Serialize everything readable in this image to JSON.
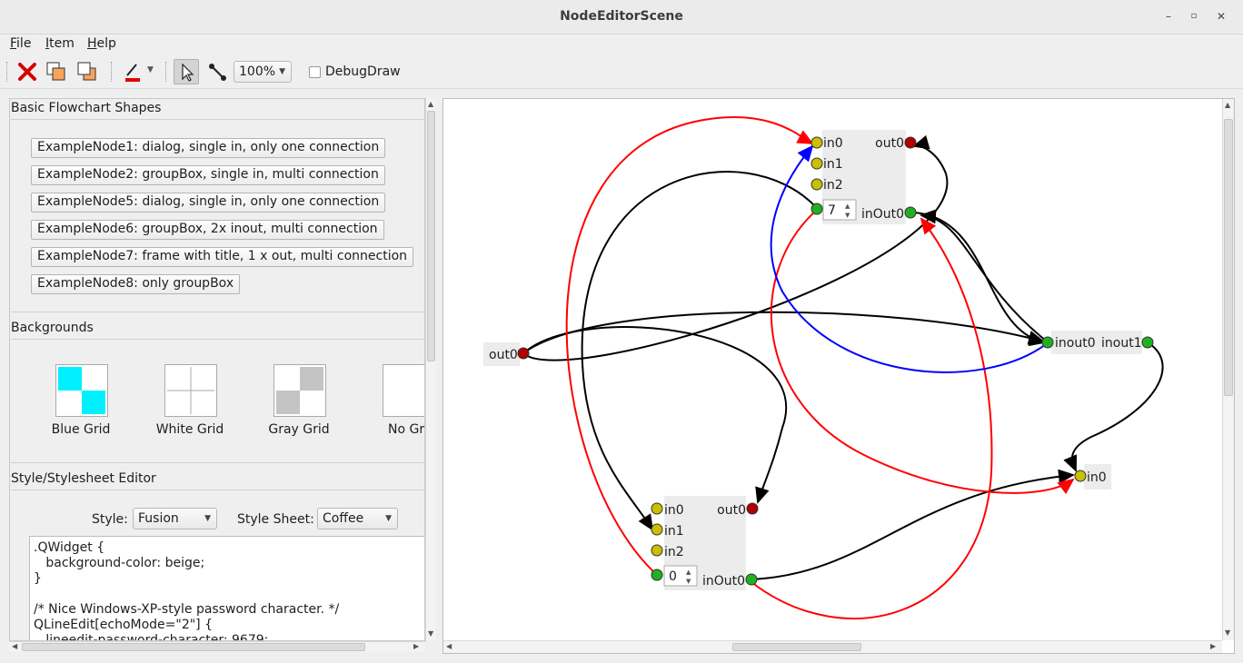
{
  "window": {
    "title": "NodeEditorScene"
  },
  "menu": {
    "items": [
      "File",
      "Item",
      "Help"
    ]
  },
  "toolbar": {
    "zoom": "100%",
    "debug_label": "DebugDraw",
    "debug_checked": false
  },
  "panel": {
    "shapes_title": "Basic Flowchart Shapes",
    "node_buttons": [
      "ExampleNode1: dialog, single in, only one connection",
      "ExampleNode2: groupBox, single in, multi connection",
      "ExampleNode5: dialog, single in, only one connection",
      "ExampleNode6: groupBox, 2x inout, multi connection",
      "ExampleNode7: frame with title, 1 x out, multi connection",
      "ExampleNode8: only groupBox"
    ],
    "backgrounds_title": "Backgrounds",
    "backgrounds": [
      "Blue Grid",
      "White Grid",
      "Gray Grid",
      "No Gri"
    ],
    "style_title": "Style/Stylesheet Editor",
    "style_label": "Style:",
    "style_value": "Fusion",
    "sheet_label": "Style Sheet:",
    "sheet_value": "Coffee",
    "editor_text": ".QWidget {\n   background-color: beige;\n}\n\n/* Nice Windows-XP-style password character. */\nQLineEdit[echoMode=\"2\"] {\n   lineedit-password-character: 9679;"
  },
  "scene": {
    "node_top": {
      "in0": "in0",
      "in1": "in1",
      "in2": "in2",
      "out0": "out0",
      "inout0": "inOut0",
      "spin": "7"
    },
    "node_bottom": {
      "in0": "in0",
      "in1": "in1",
      "in2": "in2",
      "out0": "out0",
      "inout0": "inOut0",
      "spin": "0"
    },
    "node_left": {
      "out0": "out0"
    },
    "node_right": {
      "inout0": "inout0",
      "inout1": "inout1"
    },
    "node_far": {
      "in0": "in0"
    },
    "colors": {
      "in_port": "#c8c000",
      "out_port": "#b00000",
      "inout_port": "#20b020",
      "edge_black": "#000000",
      "edge_red": "#ff0000",
      "edge_blue": "#0000ff"
    }
  }
}
